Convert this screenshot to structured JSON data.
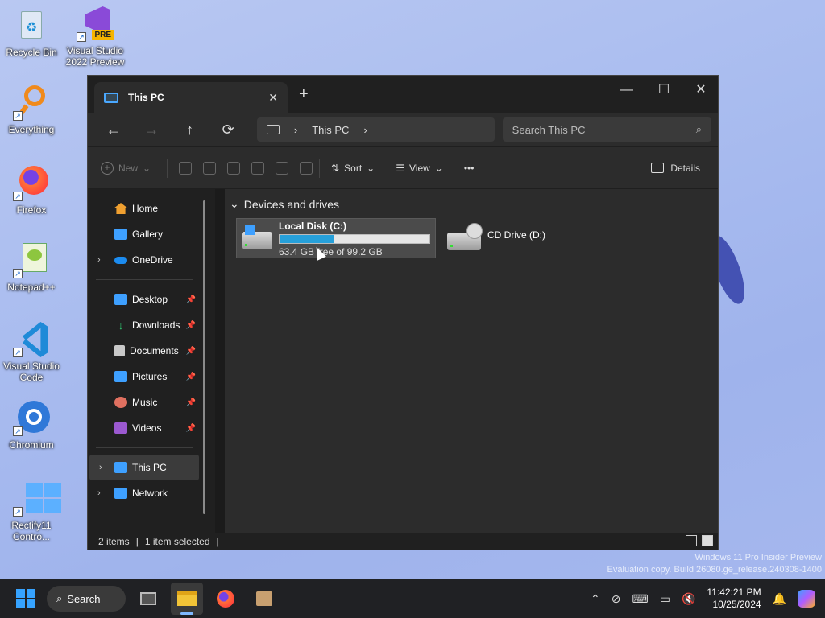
{
  "desktop": {
    "icons": [
      {
        "label": "Recycle Bin"
      },
      {
        "label": "Visual Studio 2022 Preview",
        "badge": "PRE"
      },
      {
        "label": "Everything"
      },
      {
        "label": "Firefox"
      },
      {
        "label": "Notepad++"
      },
      {
        "label": "Visual Studio Code"
      },
      {
        "label": "Chromium"
      },
      {
        "label": "Rectify11 Contro..."
      }
    ],
    "watermark_line1": "Windows 11 Pro Insider Preview",
    "watermark_line2": "Evaluation copy. Build 26080.ge_release.240308-1400"
  },
  "window": {
    "tab_title": "This PC",
    "new_tab": "+",
    "controls": {
      "minimize": "—",
      "maximize": "☐",
      "close": "✕"
    },
    "nav": {
      "back": "←",
      "forward": "→",
      "up": "↑",
      "refresh": "⟳"
    },
    "address": {
      "location": "This PC"
    },
    "search": {
      "placeholder": "Search This PC"
    },
    "commands": {
      "new": "New",
      "sort": "Sort",
      "view": "View",
      "more": "•••",
      "details": "Details"
    },
    "sidebar": {
      "quick": [
        {
          "label": "Home",
          "color": "#f0a030"
        },
        {
          "label": "Gallery",
          "color": "#3ea0ff"
        },
        {
          "label": "OneDrive",
          "color": "#1c8cf0",
          "expandable": true
        }
      ],
      "pinned": [
        {
          "label": "Desktop",
          "color": "#3ea0ff"
        },
        {
          "label": "Downloads",
          "color": "#2ecc71"
        },
        {
          "label": "Documents",
          "color": "#c8c8c8"
        },
        {
          "label": "Pictures",
          "color": "#3ea0ff"
        },
        {
          "label": "Music",
          "color": "#e07060"
        },
        {
          "label": "Videos",
          "color": "#9b59d0"
        }
      ],
      "locations": [
        {
          "label": "This PC",
          "color": "#3ea0ff",
          "selected": true
        },
        {
          "label": "Network",
          "color": "#3ea0ff"
        }
      ]
    },
    "group_title": "Devices and drives",
    "drives": [
      {
        "name": "Local Disk (C:)",
        "free_text": "63.4 GB free of 99.2 GB",
        "used_fraction": 0.36
      },
      {
        "name": "CD Drive (D:)"
      }
    ],
    "status": {
      "items": "2 items",
      "selected": "1 item selected"
    }
  },
  "taskbar": {
    "search_label": "Search",
    "time": "11:42:21 PM",
    "date": "10/25/2024"
  }
}
